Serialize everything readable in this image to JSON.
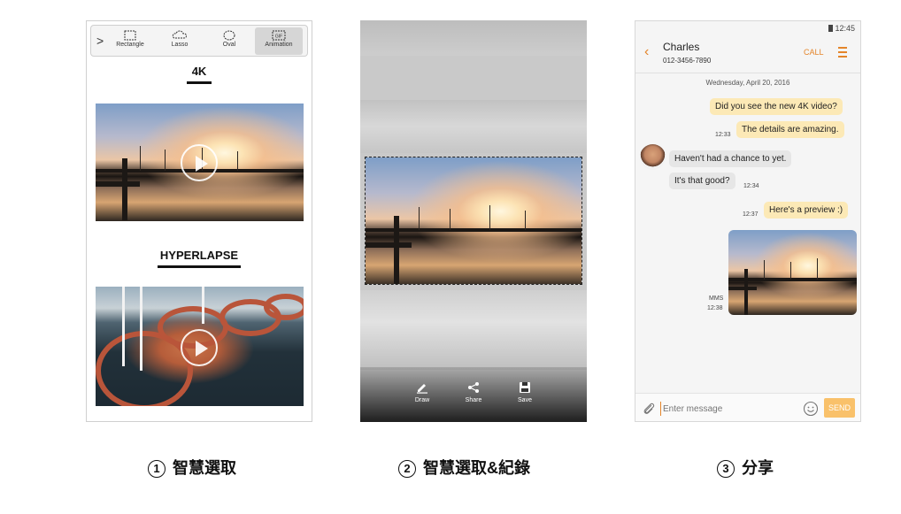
{
  "panel1": {
    "tools": [
      {
        "label": "Rectangle",
        "icon": "rectangle-select-icon"
      },
      {
        "label": "Lasso",
        "icon": "lasso-select-icon"
      },
      {
        "label": "Oval",
        "icon": "oval-select-icon"
      },
      {
        "label": "Animation",
        "icon": "gif-animation-icon",
        "active": true
      }
    ],
    "section1_title": "4K",
    "section2_title": "HYPERLAPSE"
  },
  "panel2": {
    "actions": [
      {
        "label": "Draw",
        "icon": "pen-icon"
      },
      {
        "label": "Share",
        "icon": "share-icon"
      },
      {
        "label": "Save",
        "icon": "save-icon"
      }
    ]
  },
  "panel3": {
    "status_time": "12:45",
    "contact": {
      "name": "Charles",
      "phone": "012-3456-7890"
    },
    "call_label": "CALL",
    "date": "Wednesday, April 20, 2016",
    "messages": [
      {
        "dir": "out",
        "text": "Did you see the new 4K video?"
      },
      {
        "dir": "out",
        "text": "The details are amazing.",
        "time": "12:33"
      },
      {
        "dir": "in",
        "text": "Haven't had a chance to yet."
      },
      {
        "dir": "in",
        "text": "It's that good?",
        "time": "12:34"
      },
      {
        "dir": "out",
        "text": "Here's a preview :)",
        "time": "12:37"
      }
    ],
    "mms_label": "MMS",
    "mms_time": "12:38",
    "compose_placeholder": "Enter message",
    "send_label": "SEND"
  },
  "captions": [
    {
      "num": "1",
      "text": "智慧選取"
    },
    {
      "num": "2",
      "text": "智慧選取&紀錄"
    },
    {
      "num": "3",
      "text": "分享"
    }
  ],
  "colors": {
    "accent": "#e4852a",
    "outgoing_bubble": "#fce9b6",
    "incoming_bubble": "#e6e6e6",
    "send_button": "#f9c16a"
  }
}
